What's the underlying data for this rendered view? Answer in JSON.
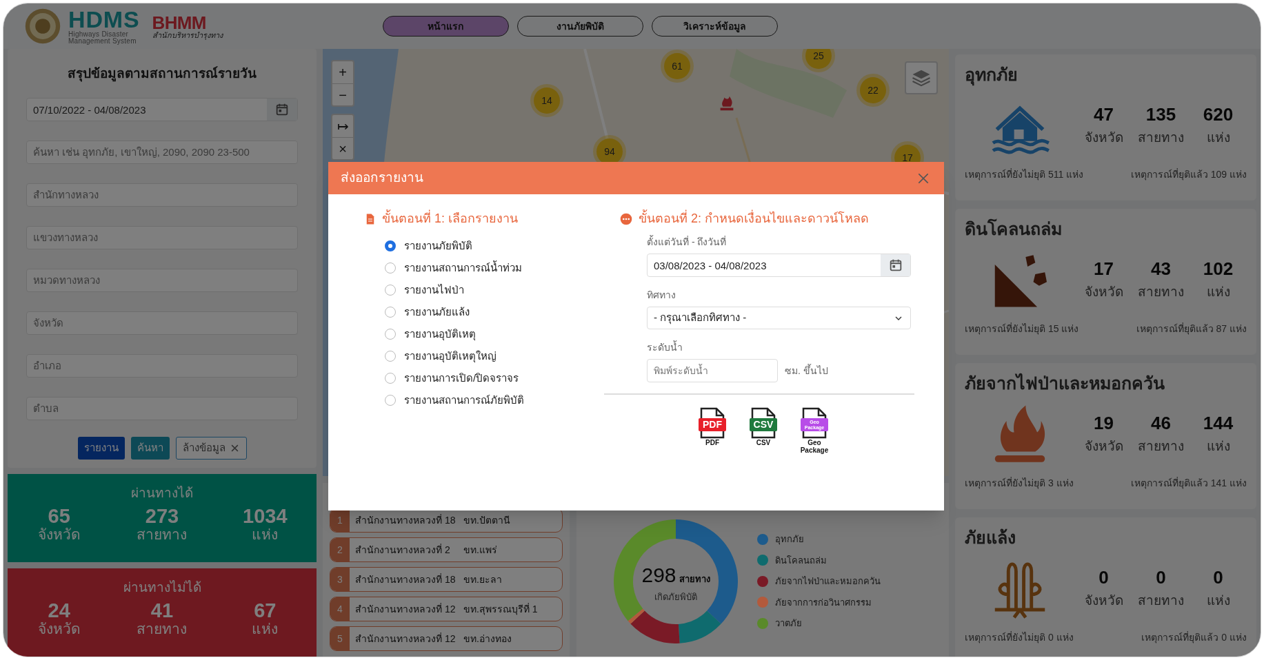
{
  "header": {
    "logo_title": "HDMS",
    "logo_subtitle": [
      "Highways Disaster",
      "Management System"
    ],
    "partner_logo": "BHMM",
    "partner_subtitle": "สำนักบริหารบำรุงทาง"
  },
  "nav": [
    {
      "label": "หน้าแรก",
      "selected": true
    },
    {
      "label": "งานภัยพิบัติ",
      "selected": false
    },
    {
      "label": "วิเคราะห์ข้อมูล",
      "selected": false
    }
  ],
  "filter_panel": {
    "title": "สรุปข้อมูลตามสถานการณ์รายวัน",
    "date_range": "07/10/2022 - 04/08/2023",
    "fields": [
      {
        "placeholder": "ค้นหา เช่น อุทกภัย, เขาใหญ่, 2090, 2090 23-500"
      },
      {
        "placeholder": "สำนักทางหลวง"
      },
      {
        "placeholder": "แขวงทางหลวง"
      },
      {
        "placeholder": "หมวดทางหลวง"
      },
      {
        "placeholder": "จังหวัด"
      },
      {
        "placeholder": "อำเภอ"
      },
      {
        "placeholder": "ตำบล"
      }
    ],
    "buttons": [
      {
        "label": "รายงาน",
        "kind": "report"
      },
      {
        "label": "ค้นหา",
        "kind": "search"
      },
      {
        "label": "ล้างข้อมูล",
        "kind": "clear"
      }
    ]
  },
  "summary_cards": [
    {
      "kind": "passable",
      "title": "ผ่านทางได้",
      "stats": [
        {
          "value": "65",
          "unit": "จังหวัด"
        },
        {
          "value": "273",
          "unit": "สายทาง"
        },
        {
          "value": "1034",
          "unit": "แห่ง"
        }
      ]
    },
    {
      "kind": "impassable",
      "title": "ผ่านทางไม่ได้",
      "stats": [
        {
          "value": "24",
          "unit": "จังหวัด"
        },
        {
          "value": "41",
          "unit": "สายทาง"
        },
        {
          "value": "67",
          "unit": "แห่ง"
        }
      ]
    }
  ],
  "map": {
    "zoom_controls": [
      "+",
      "−"
    ],
    "tool_controls": [
      "↦",
      "×"
    ],
    "clusters": [
      {
        "label": "61"
      },
      {
        "label": "25"
      },
      {
        "label": "14"
      },
      {
        "label": "22"
      },
      {
        "label": "94"
      },
      {
        "label": "17"
      }
    ]
  },
  "ranking": [
    {
      "rank": "1",
      "office": "สำนักงานทางหลวงที่ 18",
      "district": "ขท.ปัตตานี"
    },
    {
      "rank": "2",
      "office": "สำนักงานทางหลวงที่ 2",
      "district": "ขท.แพร่"
    },
    {
      "rank": "3",
      "office": "สำนักงานทางหลวงที่ 18",
      "district": "ขท.ยะลา"
    },
    {
      "rank": "4",
      "office": "สำนักงานทางหลวงที่ 12",
      "district": "ขท.สุพรรณบุรีที่ 1"
    },
    {
      "rank": "5",
      "office": "สำนักงานทางหลวงที่ 12",
      "district": "ขท.อ่างทอง"
    }
  ],
  "donut": {
    "total": "298",
    "unit": "สายทาง",
    "caption": "เกิดภัยพิบัติ",
    "legend": [
      {
        "label": "อุทกภัย",
        "color": "#1d5b8c"
      },
      {
        "label": "ดินโคลนถล่ม",
        "color": "#0f6b6e"
      },
      {
        "label": "ภัยจากไฟป่าและหมอกควัน",
        "color": "#7a1a26"
      },
      {
        "label": "ภัยจากการก่อวินาศกรรม",
        "color": "#b35a3c"
      },
      {
        "label": "วาตภัย",
        "color": "#5a8a2a"
      }
    ]
  },
  "hazard_cards": [
    {
      "kind": "flood",
      "title": "อุทกภัย",
      "stats": [
        {
          "value": "47",
          "unit": "จังหวัด"
        },
        {
          "value": "135",
          "unit": "สายทาง"
        },
        {
          "value": "620",
          "unit": "แห่ง"
        }
      ],
      "ongoing": "เหตุการณ์ที่ยังไม่ยุติ 511 แห่ง",
      "resolved": "เหตุการณ์ที่ยุติแล้ว 109 แห่ง"
    },
    {
      "kind": "landslide",
      "title": "ดินโคลนถล่ม",
      "stats": [
        {
          "value": "17",
          "unit": "จังหวัด"
        },
        {
          "value": "43",
          "unit": "สายทาง"
        },
        {
          "value": "102",
          "unit": "แห่ง"
        }
      ],
      "ongoing": "เหตุการณ์ที่ยังไม่ยุติ 15 แห่ง",
      "resolved": "เหตุการณ์ที่ยุติแล้ว 87 แห่ง"
    },
    {
      "kind": "fire",
      "title": "ภัยจากไฟป่าและหมอกควัน",
      "stats": [
        {
          "value": "19",
          "unit": "จังหวัด"
        },
        {
          "value": "46",
          "unit": "สายทาง"
        },
        {
          "value": "144",
          "unit": "แห่ง"
        }
      ],
      "ongoing": "เหตุการณ์ที่ยังไม่ยุติ 3 แห่ง",
      "resolved": "เหตุการณ์ที่ยุติแล้ว 141 แห่ง"
    },
    {
      "kind": "drought",
      "title": "ภัยแล้ง",
      "stats": [
        {
          "value": "0",
          "unit": "จังหวัด"
        },
        {
          "value": "0",
          "unit": "สายทาง"
        },
        {
          "value": "0",
          "unit": "แห่ง"
        }
      ],
      "ongoing": "เหตุการณ์ที่ยังไม่ยุติ 0 แห่ง",
      "resolved": "เหตุการณ์ที่ยุติแล้ว 0 แห่ง"
    }
  ],
  "modal": {
    "title": "ส่งออกรายงาน",
    "step1_title": "ขั้นตอนที่ 1: เลือกรายงาน",
    "reports": [
      {
        "label": "รายงานภัยพิบัติ",
        "selected": true
      },
      {
        "label": "รายงานสถานการณ์น้ำท่วม",
        "selected": false
      },
      {
        "label": "รายงานไฟป่า",
        "selected": false
      },
      {
        "label": "รายงานภัยแล้ง",
        "selected": false
      },
      {
        "label": "รายงานอุบัติเหตุ",
        "selected": false
      },
      {
        "label": "รายงานอุบัติเหตุใหญ่",
        "selected": false
      },
      {
        "label": "รายงานการเปิด/ปิดจราจร",
        "selected": false
      },
      {
        "label": "รายงานสถานการณ์ภัยพิบัติ",
        "selected": false
      }
    ],
    "step2_title": "ขั้นตอนที่ 2: กำหนดเงื่อนไขและดาวน์โหลด",
    "date_label": "ตั้งแต่วันที่ - ถึงวันที่",
    "date_range": "03/08/2023 - 04/08/2023",
    "direction_label": "ทิศทาง",
    "direction_value": "- กรุณาเลือกทิศทาง -",
    "water_label": "ระดับน้ำ",
    "water_placeholder": "พิมพ์ระดับน้ำ",
    "water_unit": "ซม. ขึ้นไป",
    "downloads": [
      {
        "kind": "pdf",
        "badge": "PDF",
        "label": "PDF"
      },
      {
        "kind": "csv",
        "badge": "CSV",
        "label": "CSV"
      },
      {
        "kind": "gpkg",
        "badge": "Geo Package",
        "label": "Geo Package"
      }
    ]
  }
}
